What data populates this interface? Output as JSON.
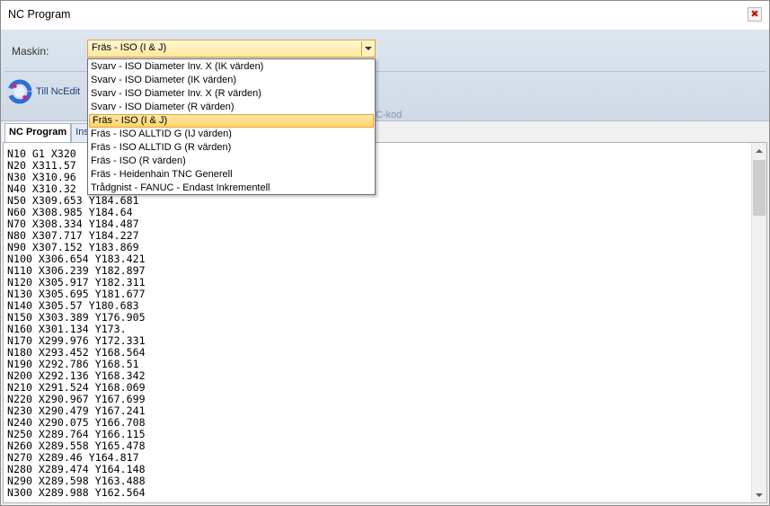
{
  "window": {
    "title": "NC Program"
  },
  "toolbar": {
    "maskin_label": "Maskin:",
    "maskin_selected": "Fräs - ISO (I & J)",
    "ncedit_label": "Till NcEdit",
    "partial_label": "C-kod"
  },
  "dropdown": {
    "items": [
      "Svarv - ISO Diameter Inv. X (IK värden)",
      "Svarv - ISO Diameter (IK värden)",
      "Svarv - ISO Diameter Inv. X (R värden)",
      "Svarv - ISO Diameter (R värden)",
      "Fräs - ISO (I & J)",
      "Fräs - ISO ALLTID G (IJ värden)",
      "Fräs - ISO ALLTID G (R värden)",
      "Fräs - ISO (R värden)",
      "Fräs - Heidenhain TNC Generell",
      "Trådgnist - FANUC - Endast Inkrementell"
    ],
    "selected_index": 4
  },
  "tabs": [
    {
      "label": "NC Program"
    },
    {
      "label": "Inst"
    }
  ],
  "code_lines": [
    "N10 G1 X320",
    "N20 X311.57",
    "N30 X310.96",
    "N40 X310.32",
    "N50 X309.653 Y184.681",
    "N60 X308.985 Y184.64",
    "N70 X308.334 Y184.487",
    "N80 X307.717 Y184.227",
    "N90 X307.152 Y183.869",
    "N100 X306.654 Y183.421",
    "N110 X306.239 Y182.897",
    "N120 X305.917 Y182.311",
    "N130 X305.695 Y181.677",
    "N140 X305.57 Y180.683",
    "N150 X303.389 Y176.905",
    "N160 X301.134 Y173.",
    "N170 X299.976 Y172.331",
    "N180 X293.452 Y168.564",
    "N190 X292.786 Y168.51",
    "N200 X292.136 Y168.342",
    "N210 X291.524 Y168.069",
    "N220 X290.967 Y167.699",
    "N230 X290.479 Y167.241",
    "N240 X290.075 Y166.708",
    "N250 X289.764 Y166.115",
    "N260 X289.558 Y165.478",
    "N270 X289.46 Y164.817",
    "N280 X289.474 Y164.148",
    "N290 X289.598 Y163.488",
    "N300 X289.988 Y162.564"
  ],
  "colors": {
    "accent": "#ffd36b",
    "toolbar_bg": "#dde6ef",
    "close_icon": "#cc1111"
  },
  "icons": {
    "close": "close-icon",
    "ncedit": "refresh-arrows-icon",
    "dropdown": "chevron-down-icon"
  }
}
